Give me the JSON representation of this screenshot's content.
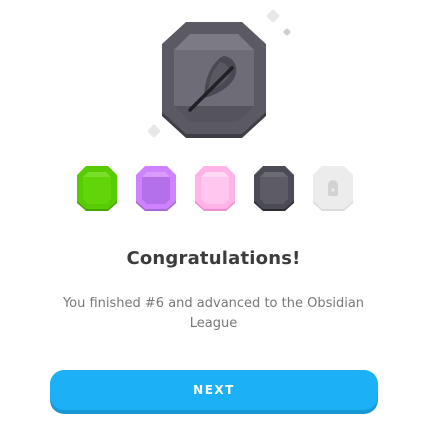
{
  "result": {
    "title": "Congratulations!",
    "message": "You finished #6 and advanced to the Obsidian League",
    "next_label": "NEXT"
  },
  "hero_badge": {
    "icon": "feather-quill-icon",
    "color": "#5b5a64"
  },
  "leagues": [
    {
      "icon": "league-gem-icon",
      "color": "#58cc02",
      "state": "unlocked"
    },
    {
      "icon": "league-gem-icon",
      "color": "#ce82ff",
      "state": "unlocked"
    },
    {
      "icon": "league-gem-icon",
      "color": "#ffb3e6",
      "state": "unlocked"
    },
    {
      "icon": "league-gem-icon",
      "color": "#4b4b55",
      "state": "current"
    },
    {
      "icon": "lock-icon",
      "color": "#e5e5e5",
      "state": "locked"
    }
  ],
  "colors": {
    "button": "#1cb0f6",
    "button_shadow": "#1899d6",
    "title": "#3c3c3c",
    "body_text": "#777777"
  }
}
